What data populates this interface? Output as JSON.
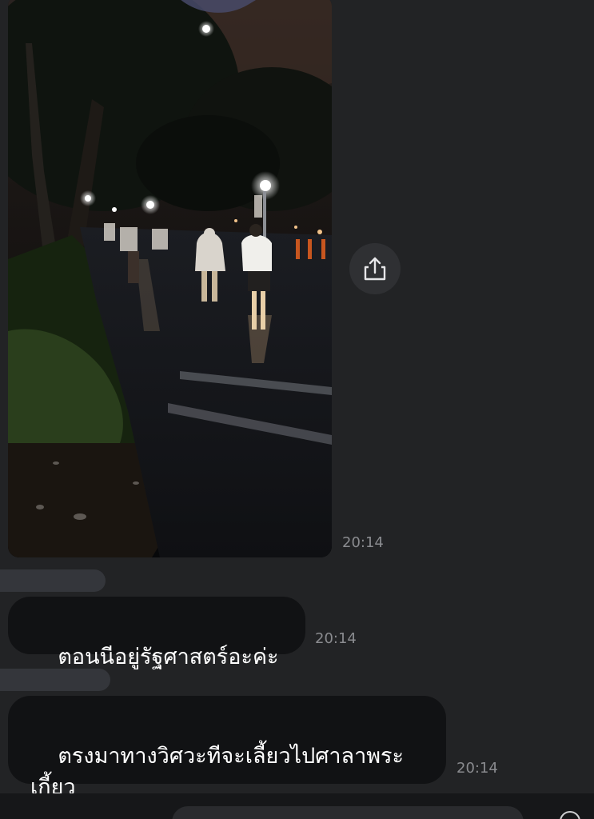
{
  "messages": [
    {
      "type": "image",
      "time": "20:14"
    },
    {
      "type": "text",
      "text": "ตอนนีอยู่รัฐศาสตร์อะค่ะ",
      "time": "20:14"
    },
    {
      "type": "text",
      "text": "ตรงมาทางวิศวะทีจะเลี้ยวไปศาลาพระ\nเกี้ยว",
      "time": "20:14"
    }
  ],
  "icons": {
    "share": "share-icon",
    "input_action": "circle-icon"
  },
  "colors": {
    "background": "#222325",
    "bubble": "#111214",
    "timestamp": "#8a8b8f"
  }
}
